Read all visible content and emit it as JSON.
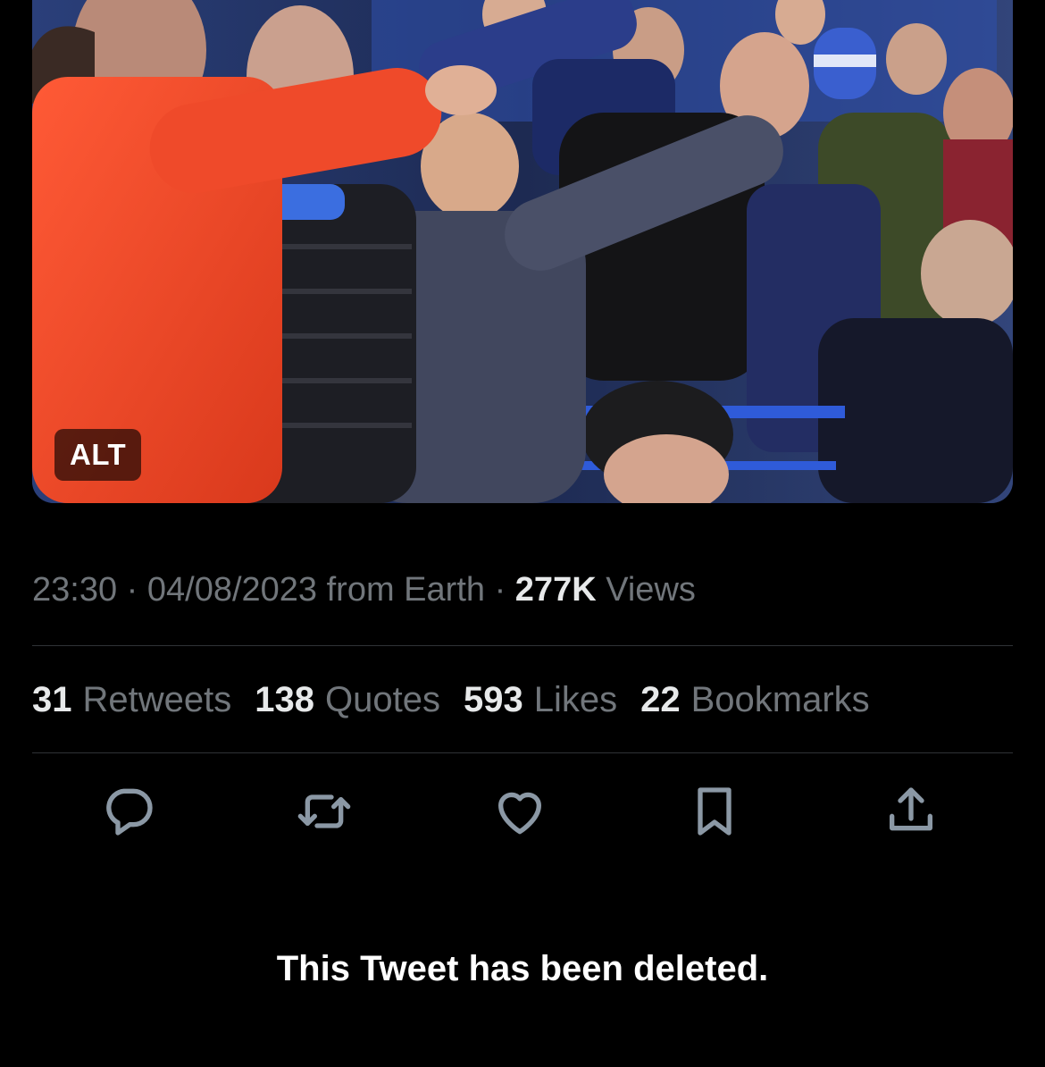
{
  "media": {
    "alt_badge": "ALT"
  },
  "meta": {
    "time": "23:30",
    "separator": "·",
    "date": "04/08/2023",
    "source": "from Earth",
    "views_count": "277K",
    "views_label": "Views"
  },
  "stats": {
    "retweets": {
      "count": "31",
      "label": "Retweets"
    },
    "quotes": {
      "count": "138",
      "label": "Quotes"
    },
    "likes": {
      "count": "593",
      "label": "Likes"
    },
    "bookmarks": {
      "count": "22",
      "label": "Bookmarks"
    }
  },
  "actions": [
    {
      "name": "reply",
      "icon": "reply-icon"
    },
    {
      "name": "retweet",
      "icon": "retweet-icon"
    },
    {
      "name": "like",
      "icon": "heart-icon"
    },
    {
      "name": "bookmark",
      "icon": "bookmark-icon"
    },
    {
      "name": "share",
      "icon": "share-icon"
    }
  ],
  "notice": {
    "deleted_text": "This Tweet has been deleted."
  },
  "colors": {
    "background": "#000000",
    "primary_text": "#e7e9ea",
    "secondary_text": "#71767b",
    "divider": "#2f3336",
    "icon": "#8b98a5"
  }
}
